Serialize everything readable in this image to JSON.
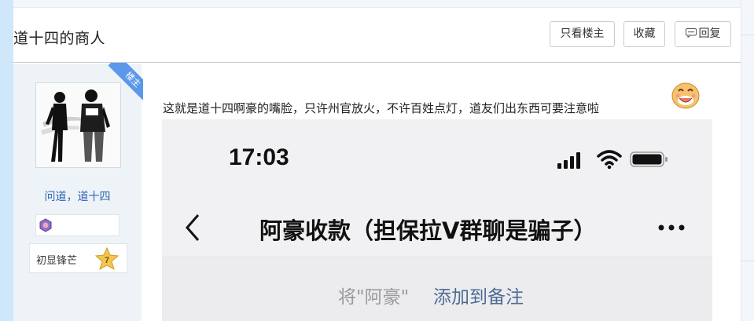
{
  "post": {
    "title": "道十四的商人",
    "buttons": {
      "only_author": "只看楼主",
      "favorite": "收藏",
      "reply": "回复"
    },
    "corner_badge": "楼主",
    "text": "这就是道十四啊豪的嘴脸，只许州官放火，不许百姓点灯，道友们出东西可要注意啦"
  },
  "author": {
    "name": "问道，道十四",
    "level_title": "初显锋芒",
    "level_number": "7"
  },
  "screenshot": {
    "time": "17:03",
    "chat_title": "阿豪收款（担保拉V群聊是骗子）",
    "note_prefix": "将\"阿豪\"",
    "note_action": "添加到备注"
  },
  "colors": {
    "link_blue": "#2d64b3",
    "ribbon_blue": "#5b98ea",
    "note_action": "#4f6b94"
  }
}
